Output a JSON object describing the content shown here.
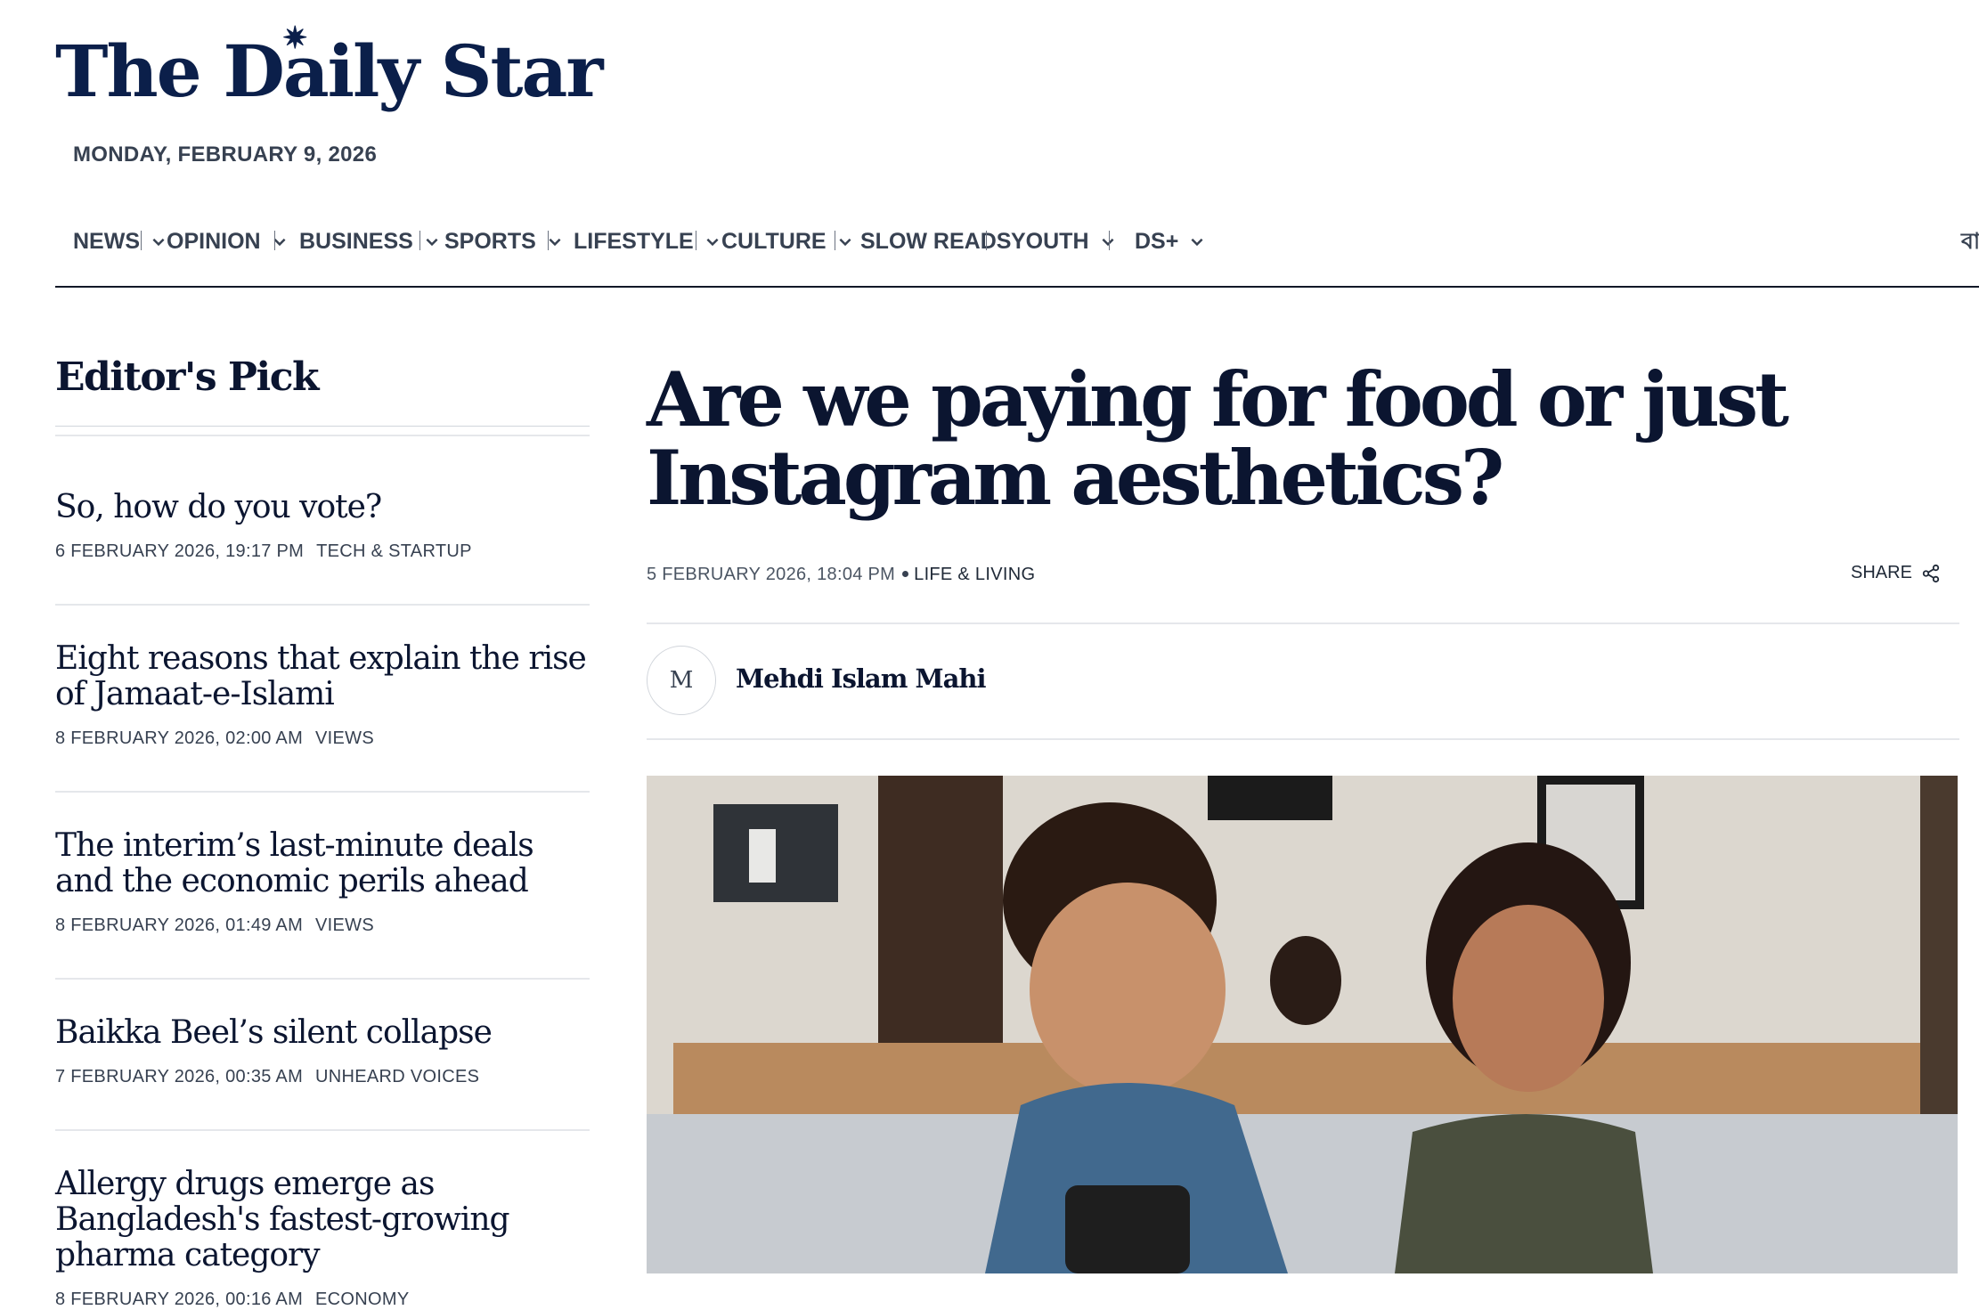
{
  "logo": {
    "text": "The Daily Star"
  },
  "date": "MONDAY, FEBRUARY 9, 2026",
  "nav": {
    "items": [
      {
        "label": "NEWS",
        "dropdown": true
      },
      {
        "label": "OPINION",
        "dropdown": true
      },
      {
        "label": "BUSINESS",
        "dropdown": true
      },
      {
        "label": "SPORTS",
        "dropdown": true
      },
      {
        "label": "LIFESTYLE",
        "dropdown": true
      },
      {
        "label": "CULTURE",
        "dropdown": true
      },
      {
        "label": "SLOW READS",
        "dropdown": false
      },
      {
        "label": "YOUTH",
        "dropdown": true
      },
      {
        "label": "DS+",
        "dropdown": true
      }
    ],
    "language": "বা"
  },
  "editors_pick": {
    "title": "Editor's Pick",
    "items": [
      {
        "title": "So, how do you vote?",
        "date": "6 FEBRUARY 2026, 19:17 PM",
        "category": "TECH & STARTUP"
      },
      {
        "title": "Eight reasons that explain the rise of Jamaat-e-Islami",
        "date": "8 FEBRUARY 2026, 02:00 AM",
        "category": "VIEWS"
      },
      {
        "title": "The interim’s last-minute deals and the economic perils ahead",
        "date": "8 FEBRUARY 2026, 01:49 AM",
        "category": "VIEWS"
      },
      {
        "title": "Baikka Beel’s silent collapse",
        "date": "7 FEBRUARY 2026, 00:35 AM",
        "category": "UNHEARD VOICES"
      },
      {
        "title": "Allergy drugs emerge as Bangladesh's fastest-growing pharma category",
        "date": "8 FEBRUARY 2026, 00:16 AM",
        "category": "ECONOMY"
      }
    ]
  },
  "article": {
    "headline": "Are we paying for food or just Instagram aesthetics?",
    "date": "5 FEBRUARY 2026, 18:04 PM",
    "category": "LIFE & LIVING",
    "share_label": "SHARE",
    "author": {
      "initial": "M",
      "name": "Mehdi Islam Mahi"
    }
  },
  "colors": {
    "brand": "#0b1f4a",
    "text": "#0b1530",
    "meta": "#374151"
  }
}
